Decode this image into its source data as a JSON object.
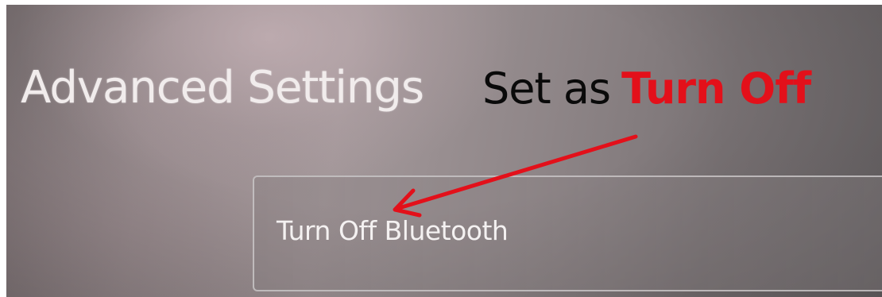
{
  "header": {
    "title": "Advanced Settings"
  },
  "annotation": {
    "prefix": "Set as",
    "emphasis": "Turn Off",
    "emphasis_color": "#e3101a",
    "arrow_color": "#e3101a"
  },
  "options": [
    {
      "label": "Turn Off Bluetooth"
    }
  ]
}
